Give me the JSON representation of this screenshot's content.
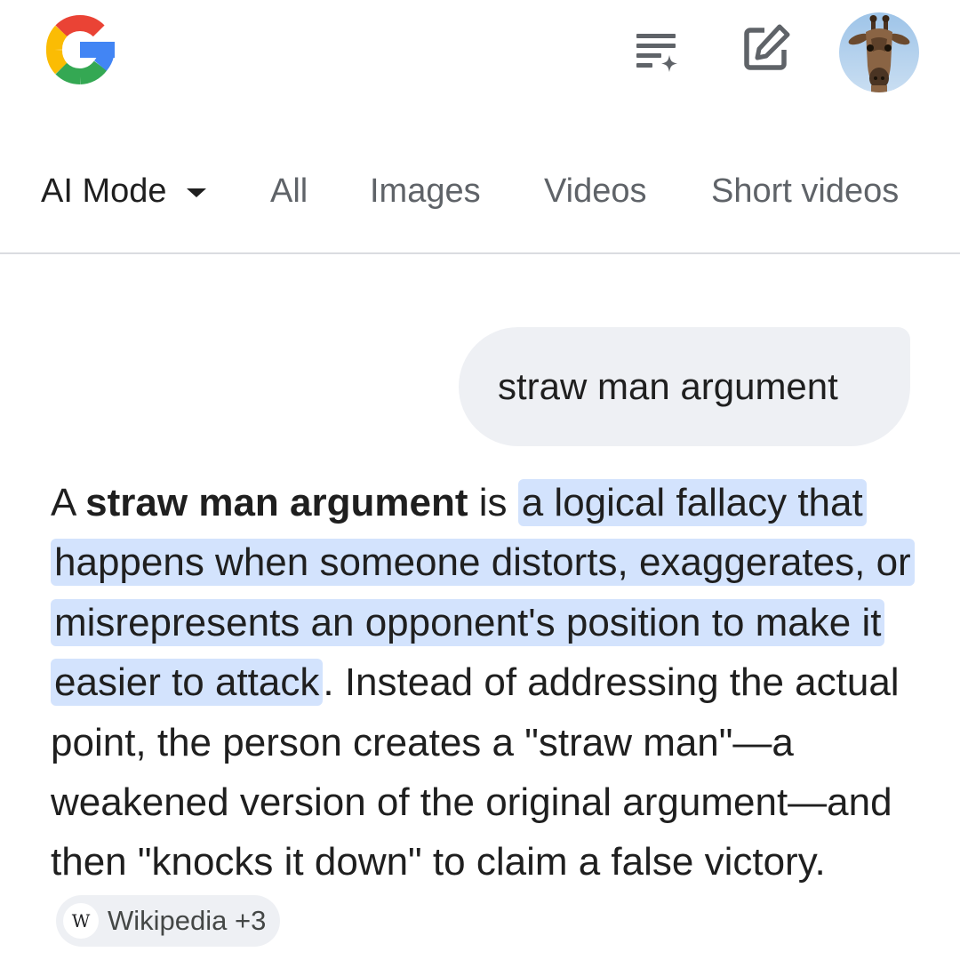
{
  "header": {
    "logo_icon": "google-g-logo",
    "history_icon": "ai-history-icon",
    "new_chat_icon": "new-chat-edit-icon",
    "avatar_icon": "giraffe-avatar"
  },
  "tabs": [
    {
      "label": "AI Mode",
      "active": true,
      "has_dropdown": true
    },
    {
      "label": "All",
      "active": false
    },
    {
      "label": "Images",
      "active": false
    },
    {
      "label": "Videos",
      "active": false
    },
    {
      "label": "Short videos",
      "active": false
    }
  ],
  "query": {
    "text": "straw man argument"
  },
  "answer": {
    "intro": "A ",
    "term": "straw man argument",
    "is": " is ",
    "highlight": "a logical fallacy that happens when someone distorts, exaggerates, or misrepresents an opponent's position to make it easier to attack",
    "rest": ". Instead of addressing the actual point, the person creates a \"straw man\"—a weakened version of the original argument—and then \"knocks it down\" to claim a false victory.",
    "source_chip": {
      "label": "Wikipedia +3",
      "icon_letter": "W"
    }
  },
  "colors": {
    "highlight": "#d3e3fd",
    "bubble": "#eef0f4",
    "text": "#1f1f1f",
    "muted": "#5f6368"
  }
}
